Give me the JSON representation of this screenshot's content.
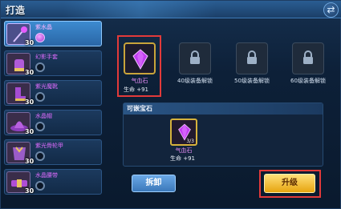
{
  "window": {
    "title": "打造",
    "close_icon": "swap-arrows-icon"
  },
  "equipment_list": [
    {
      "name": "紫水晶",
      "level": "30",
      "icon": "magic-staff-icon",
      "selected": true,
      "gem": true
    },
    {
      "name": "幻影手套",
      "level": "30",
      "icon": "glove-icon",
      "selected": false,
      "gem": false
    },
    {
      "name": "紫光魔靴",
      "level": "30",
      "icon": "boots-icon",
      "selected": false,
      "gem": false
    },
    {
      "name": "水晶帽",
      "level": "30",
      "icon": "hat-icon",
      "selected": false,
      "gem": false
    },
    {
      "name": "紫光骨轮甲",
      "level": "30",
      "icon": "armor-icon",
      "selected": false,
      "gem": false
    },
    {
      "name": "水晶腰带",
      "level": "30",
      "icon": "belt-icon",
      "selected": false,
      "gem": false
    }
  ],
  "gem_slots": [
    {
      "type": "gem",
      "title": "气血石",
      "stat": "生命 +91"
    },
    {
      "type": "locked",
      "label": "40级装备解锁"
    },
    {
      "type": "locked",
      "label": "50级装备解锁"
    },
    {
      "type": "locked",
      "label": "60级装备解锁"
    }
  ],
  "inlay": {
    "title": "可嵌宝石",
    "items": [
      {
        "name": "气血石",
        "count": "3/3",
        "stat": "生命 +91"
      }
    ]
  },
  "buttons": {
    "remove": "拆卸",
    "upgrade": "升级"
  },
  "colors": {
    "highlight_box": "#e23a3a",
    "gem_purple": "#c23df0",
    "gold_border": "#d6b23c"
  }
}
